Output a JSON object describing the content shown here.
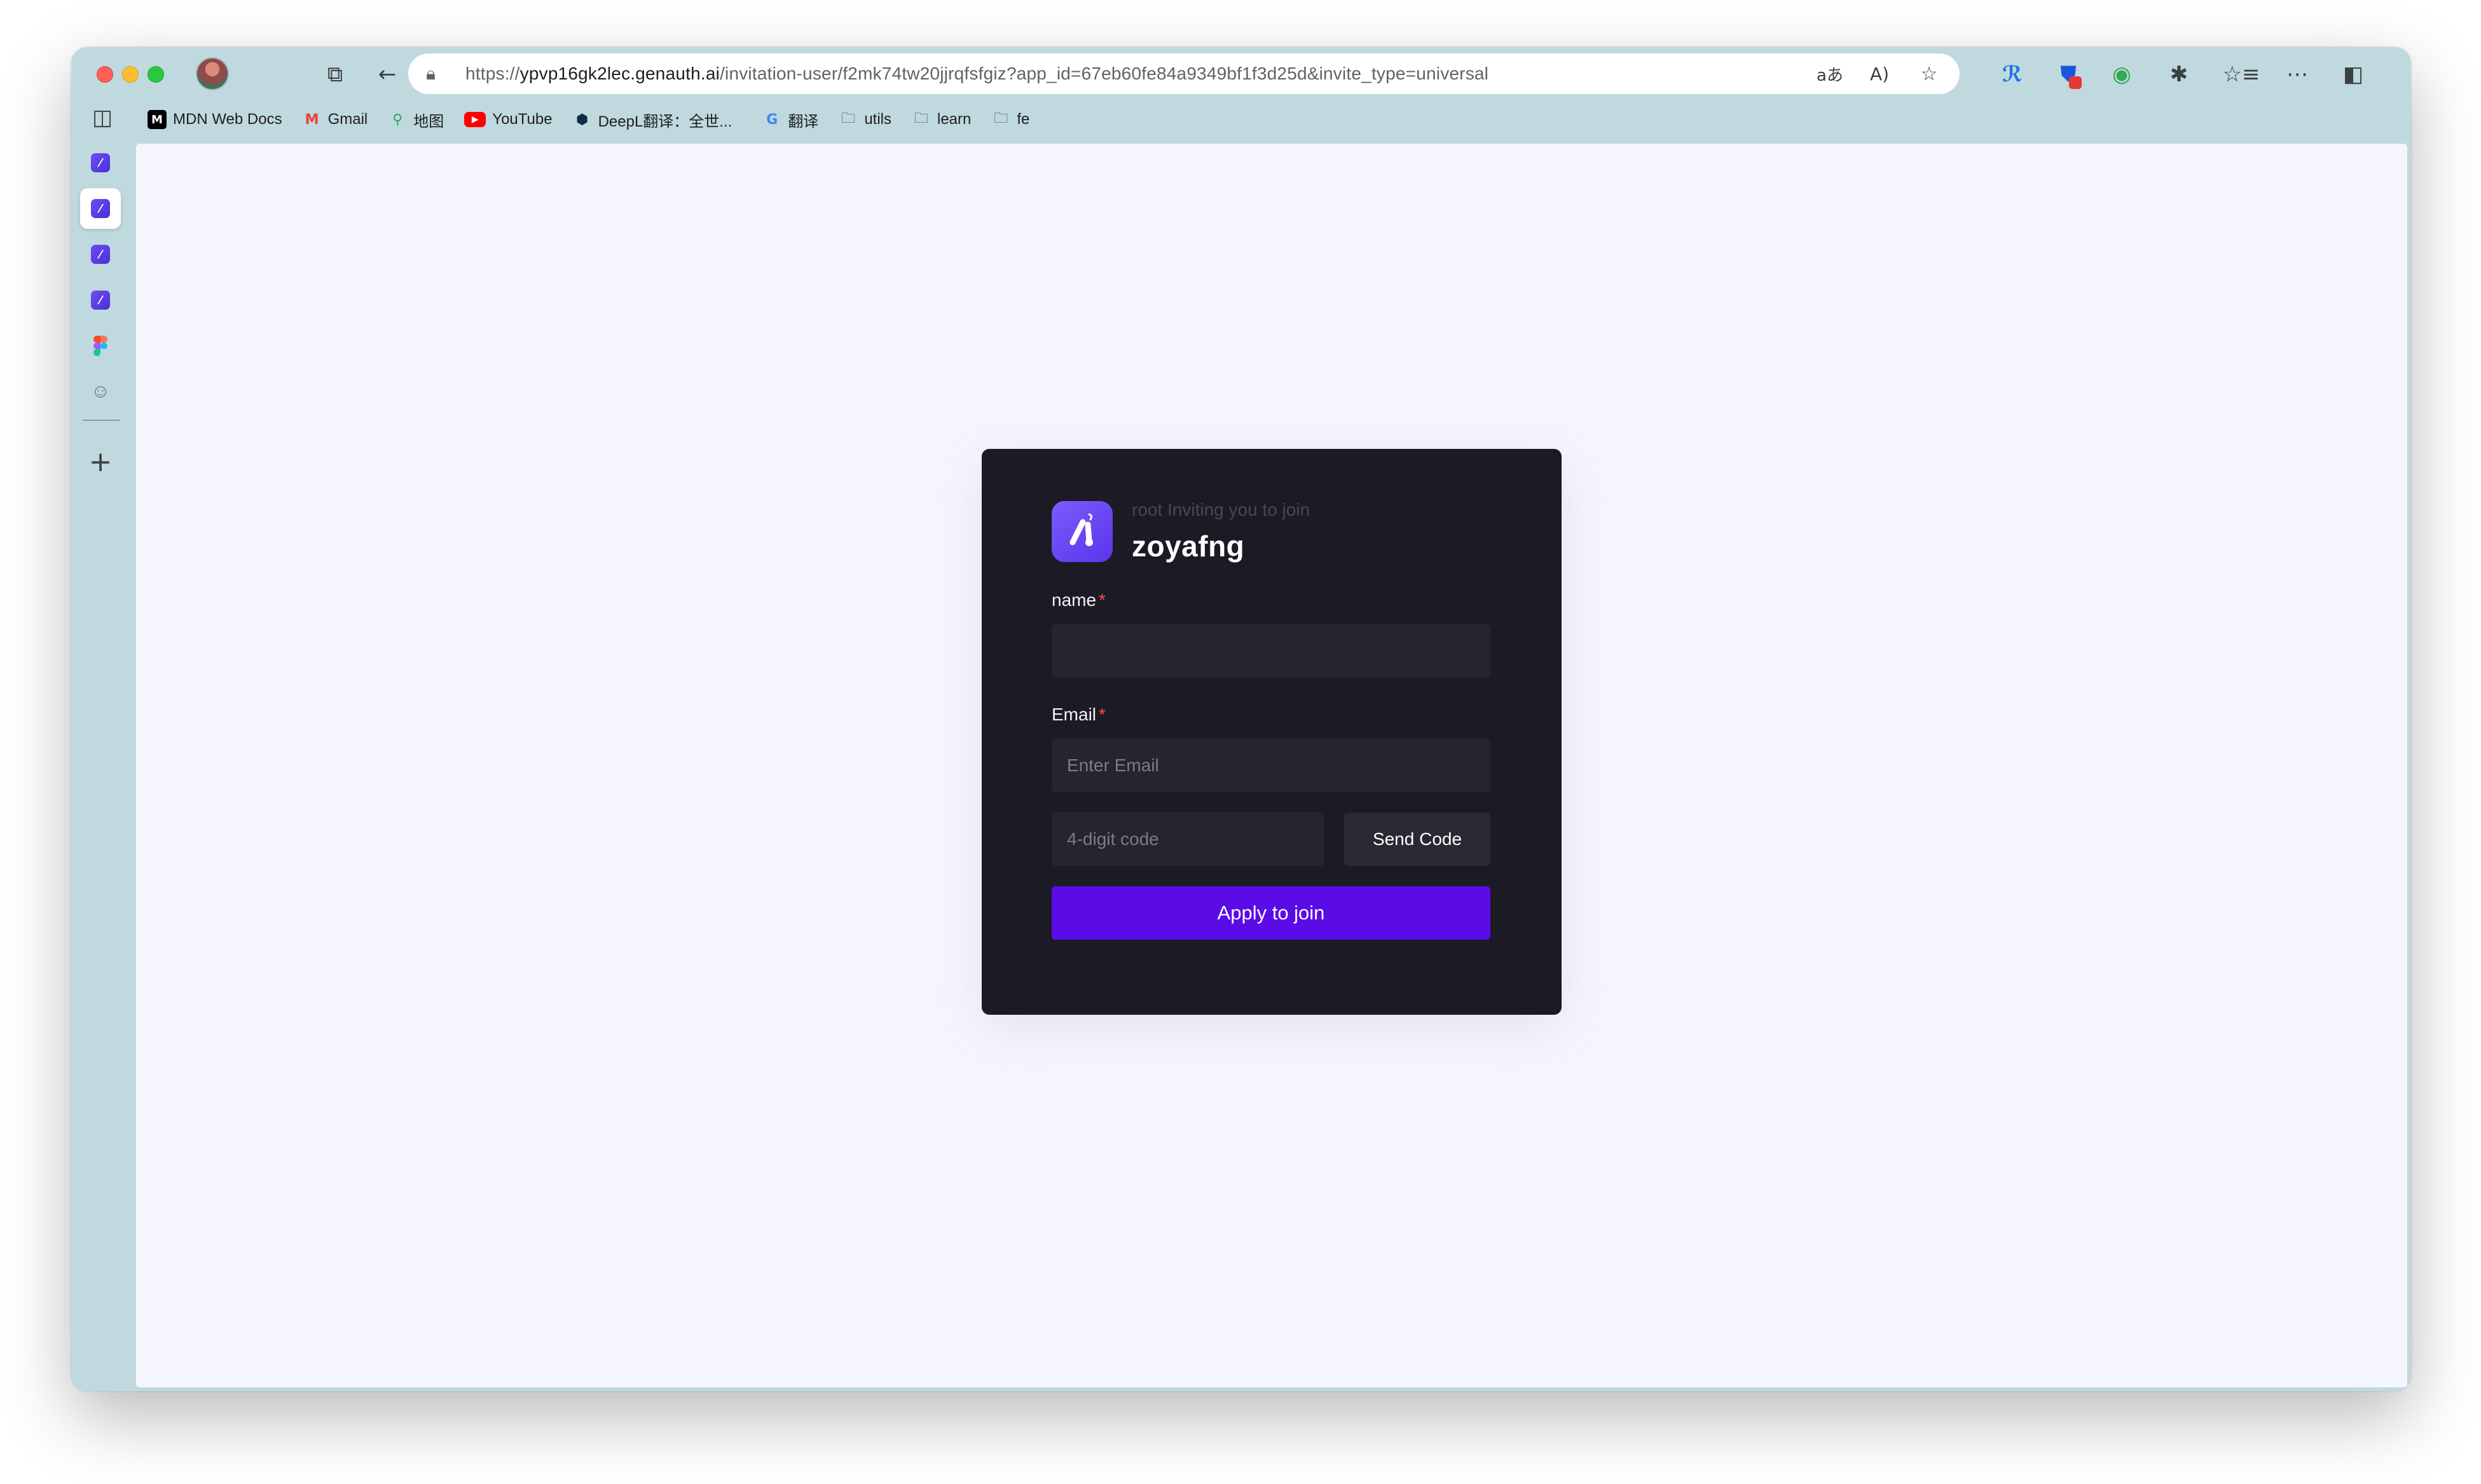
{
  "browser": {
    "url_scheme": "https://",
    "url_host": "ypvp16gk2lec.genauth.ai",
    "url_path": "/invitation-user/f2mk74tw20jjrqfsfgiz?app_id=67eb60fe84a9349bf1f3d25d&invite_type=universal",
    "bookmarks": [
      {
        "label": "MDN Web Docs",
        "icon": "mdn-icon"
      },
      {
        "label": "Gmail",
        "icon": "gmail-icon"
      },
      {
        "label": "地图",
        "icon": "maps-icon"
      },
      {
        "label": "YouTube",
        "icon": "youtube-icon"
      },
      {
        "label": "DeepL翻译：全世...",
        "icon": "deepl-icon"
      },
      {
        "label": "翻译",
        "icon": "translate-icon"
      },
      {
        "label": "utils",
        "icon": "folder-icon"
      },
      {
        "label": "learn",
        "icon": "folder-icon"
      },
      {
        "label": "fe",
        "icon": "folder-icon"
      }
    ]
  },
  "invite": {
    "subtitle": "root Inviting you to join",
    "title": "zoyafng",
    "name_label": "name",
    "email_label": "Email",
    "required_mark": "*",
    "email_placeholder": "Enter Email",
    "code_placeholder": "4-digit code",
    "send_code_label": "Send Code",
    "apply_label": "Apply to join"
  },
  "colors": {
    "card_bg": "#1c1a25",
    "accent": "#5b0ce6",
    "page_bg": "#f5f6fd",
    "chrome_bg": "#bfd9de"
  }
}
